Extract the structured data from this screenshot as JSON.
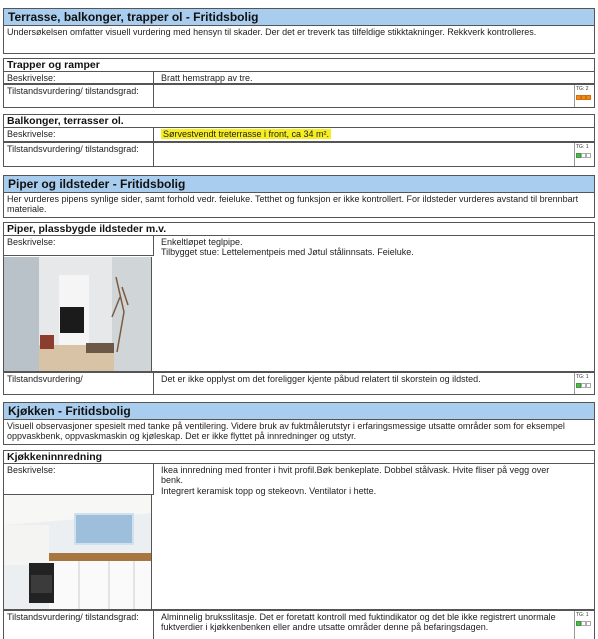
{
  "sections": [
    {
      "title": "Terrasse, balkonger, trapper ol - Fritidsbolig",
      "intro": "Undersøkelsen omfatter visuell vurdering med hensyn til skader. Der det er treverk tas tilfeldige stikktakninger. Rekkverk kontrolleres.",
      "items": [
        {
          "title": "Trapper og ramper",
          "desc_label": "Beskrivelse:",
          "desc": "Bratt hemstrapp av tre.",
          "tg_label": "Tilstandsvurdering/ tilstandsgrad:",
          "tg_value": "",
          "tg_badge": "TG: 2",
          "tg_level": 2
        },
        {
          "title": "Balkonger, terrasser ol.",
          "desc_label": "Beskrivelse:",
          "desc": "Sørvestvendt treterrasse i front, ca 34 m².",
          "tg_label": "Tilstandsvurdering/ tilstandsgrad:",
          "tg_value": "",
          "tg_badge": "TG: 1",
          "tg_level": 1
        }
      ]
    },
    {
      "title": "Piper og ildsteder - Fritidsbolig",
      "intro": "Her vurderes pipens synlige sider, samt forhold vedr. feieluke. Tetthet og funksjon er ikke kontrollert. For ildsteder vurderes avstand til brennbart materiale.",
      "items": [
        {
          "title": "Piper, plassbygde ildsteder m.v.",
          "desc_label": "Beskrivelse:",
          "desc_lines": [
            "Enkeltløpet teglpipe.",
            "Tilbygget stue: Lettelementpeis med Jøtul stålinnsats. Feieluke."
          ],
          "tg_label": "Tilstandsvurdering/",
          "tg_value": "Det er ikke opplyst om det foreligger kjente påbud relatert til skorstein og ildsted.",
          "tg_badge": "TG: 1",
          "tg_level": 1
        }
      ]
    },
    {
      "title": "Kjøkken - Fritidsbolig",
      "intro": "Visuell observasjoner spesielt med tanke på ventilering. Videre bruk av fuktmålerutstyr i erfaringsmessige utsatte områder som for eksempel oppvaskbenk, oppvaskmaskin og kjøleskap. Det er ikke flyttet på innredninger og utstyr.",
      "items": [
        {
          "title": "Kjøkkeninnredning",
          "desc_label": "Beskrivelse:",
          "desc_lines": [
            "Ikea innredning med fronter i hvit profil.Bøk benkeplate. Dobbel stålvask. Hvite fliser på vegg over benk.",
            "Integrert keramisk topp og stekeovn. Ventilator i hette."
          ],
          "tg_label": "Tilstandsvurdering/ tilstandsgrad:",
          "tg_value": "Alminnelig bruksslitasje. Det er foretatt kontroll med fuktindikator og det ble ikke registrert unormale fuktverdier i kjøkkenbenken eller andre utsatte områder denne på befaringsdagen.",
          "tg_badge": "TG: 1",
          "tg_level": 1
        }
      ]
    }
  ],
  "colors": {
    "section_header_bg": "#a9cdee",
    "highlight": "#f6ee1d",
    "tg2": "#ef8a16",
    "tg1": "#4fb848"
  }
}
